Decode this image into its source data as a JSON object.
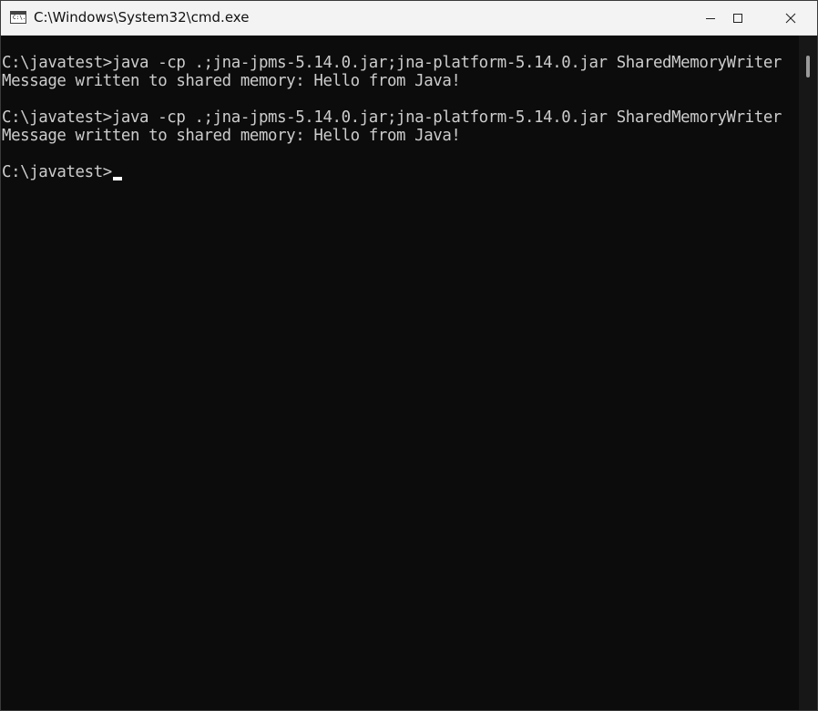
{
  "window": {
    "title": "C:\\Windows\\System32\\cmd.exe",
    "icon_name": "cmd-icon",
    "icon_glyph": "C:\\."
  },
  "controls": {
    "minimize_icon": "minimize-icon",
    "maximize_icon": "maximize-icon",
    "close_icon": "close-icon"
  },
  "console": {
    "lines": [
      "C:\\javatest>java -cp .;jna-jpms-5.14.0.jar;jna-platform-5.14.0.jar SharedMemoryWriter",
      "Message written to shared memory: Hello from Java!",
      "",
      "C:\\javatest>java -cp .;jna-jpms-5.14.0.jar;jna-platform-5.14.0.jar SharedMemoryWriter",
      "Message written to shared memory: Hello from Java!",
      "",
      "C:\\javatest>"
    ],
    "foreground": "#cccccc",
    "background": "#0c0c0c"
  }
}
